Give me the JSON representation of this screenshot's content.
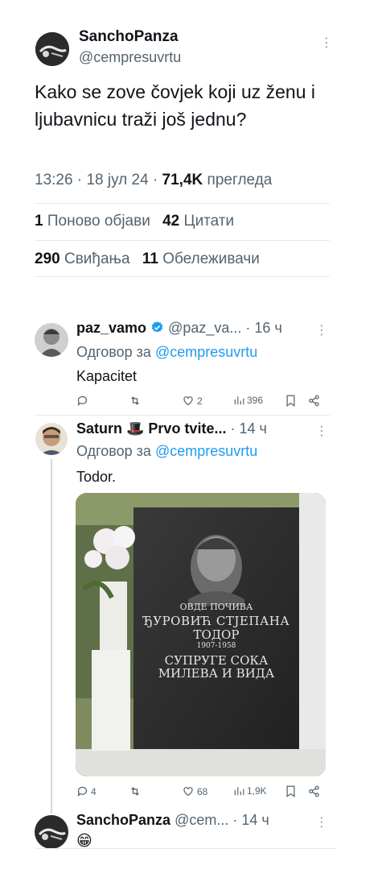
{
  "main": {
    "author_name": "SanchoPanza",
    "author_handle": "@cempresuvrtu",
    "text": "Kako se zove čovjek koji uz ženu i ljubavnicu traži još jednu?",
    "time": "13:26",
    "date": "18 јул 24",
    "views_count": "71,4K",
    "views_label": "прегледа",
    "reposts_count": "1",
    "reposts_label": "Поново објави",
    "quotes_count": "42",
    "quotes_label": "Цитати",
    "likes_count": "290",
    "likes_label": "Свиђања",
    "bookmarks_count": "11",
    "bookmarks_label": "Обележивачи"
  },
  "replies": [
    {
      "name": "paz_vamo",
      "handle": "@paz_va...",
      "time": "16 ч",
      "reply_prefix": "Одговор за",
      "reply_to": "@cempresuvrtu",
      "text": "Kapacitet",
      "actions": {
        "replies": "",
        "reposts": "",
        "likes": "2",
        "views": "396"
      }
    },
    {
      "name": "Saturn 🎩 Prvo tvite...",
      "time": "14 ч",
      "reply_prefix": "Одговор за",
      "reply_to": "@cempresuvrtu",
      "text": "Todor.",
      "image_text": {
        "line1": "ОВДЕ ПОЧИВА",
        "line2": "ЂУРОВИЋ СТЈЕПАНА",
        "line3": "ТОДОР",
        "line4": "1907-1958",
        "line5": "СУПРУГЕ СОКА",
        "line6": "МИЛЕВА И ВИДА"
      },
      "actions": {
        "replies": "4",
        "reposts": "",
        "likes": "68",
        "views": "1,9K"
      }
    },
    {
      "name": "SanchoPanza",
      "handle": "@cem...",
      "time": "14 ч",
      "text": "😁"
    }
  ],
  "colors": {
    "accent": "#1d9bf0",
    "text": "#0f1419",
    "muted": "#536471"
  }
}
